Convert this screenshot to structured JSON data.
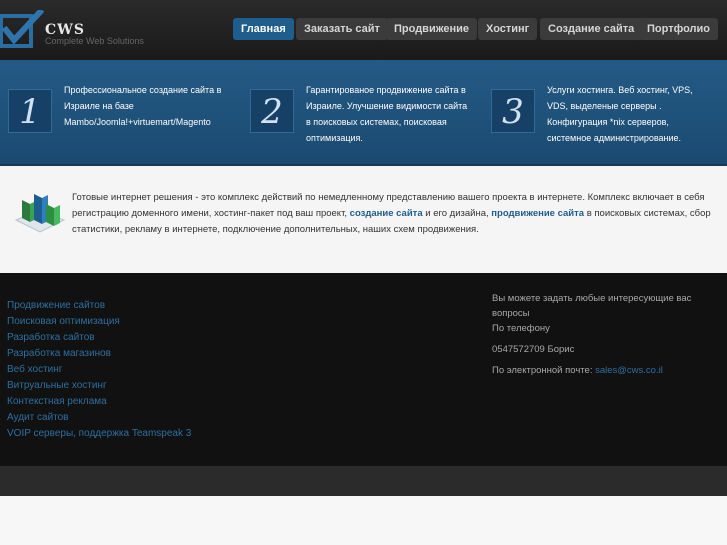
{
  "header": {
    "logo_text": "CWS",
    "logo_subtitle": "Complete Web Solutions",
    "nav": [
      {
        "label": "Главная",
        "active": true
      },
      {
        "label": "Заказать сайт"
      },
      {
        "label": "Продвижение"
      },
      {
        "label": "Хостинг"
      },
      {
        "label": "Создание сайта"
      },
      {
        "label": "Портфолио"
      }
    ]
  },
  "features": [
    {
      "number": "1",
      "lines": [
        "Профессиональное создание сайта в",
        "Израиле на базе",
        "Mambo/Joomla!+virtuemart/Magento"
      ]
    },
    {
      "number": "2",
      "lines": [
        "Гарантированое продвижение сайта в",
        "Израиле. Улучшение видимости сайта",
        "в поисковых системах, поисковая",
        "оптимизация."
      ]
    },
    {
      "number": "3",
      "lines": [
        "Услуги хостинга. Веб хостинг, VPS,",
        "VDS, выделеные серверы .",
        "Конфигурация *nix серверов,",
        "системное администрирование."
      ]
    }
  ],
  "intro": {
    "text_before": "Готовые интернет решения - это комплекс действий по немедленному представлению вашего проекта в интернете. Комплекс включает в себя регистрацию доменного имени, хостинг-пакет под ваш проект, ",
    "link1": "создание сайта",
    "text_middle": " и его дизайна, ",
    "link2": "продвижение сайта",
    "text_after": " в поисковых системах, сбор статистики, рекламу в интернете, подключение дополнительных, наших схем продвижения."
  },
  "footer": {
    "links": [
      "Продвижение сайтов",
      "Поисковая оптимизация",
      "Разработка сайтов",
      "Разработка магазинов",
      "Веб хостинг",
      "Витруальные хостинг",
      "Контекстная реклама",
      "Аудит сайтов",
      "VOIP серверы, поддержка Teamspeak 3"
    ],
    "contact": {
      "question_line1": "Вы можете задать любые интересующие вас",
      "question_line2": "вопросы",
      "phone_label": "По телефону",
      "phone": "0547572709 Борис",
      "email_label": "По электронной почте: ",
      "email": "sales@cws.co.il"
    }
  },
  "colors": {
    "accent": "#1f5d8c",
    "band": "#245a85",
    "link": "#2e6fa0"
  }
}
